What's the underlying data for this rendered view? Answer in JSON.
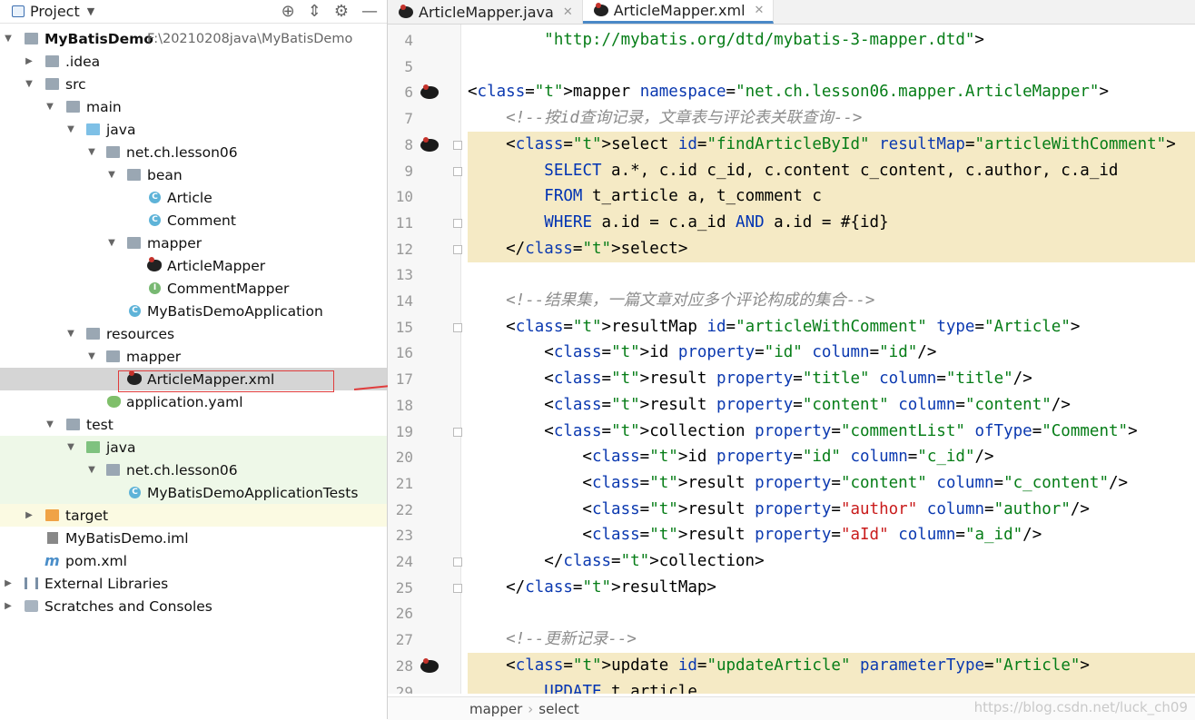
{
  "project_panel": {
    "title": "Project",
    "tree": [
      {
        "label": "MyBatisDemo",
        "path": "F:\\20210208java\\MyBatisDemo",
        "bold": true
      },
      {
        "label": ".idea"
      },
      {
        "label": "src"
      },
      {
        "label": "main"
      },
      {
        "label": "java"
      },
      {
        "label": "net.ch.lesson06"
      },
      {
        "label": "bean"
      },
      {
        "label": "Article"
      },
      {
        "label": "Comment"
      },
      {
        "label": "mapper"
      },
      {
        "label": "ArticleMapper"
      },
      {
        "label": "CommentMapper"
      },
      {
        "label": "MyBatisDemoApplication"
      },
      {
        "label": "resources"
      },
      {
        "label": "mapper"
      },
      {
        "label": "ArticleMapper.xml"
      },
      {
        "label": "application.yaml"
      },
      {
        "label": "test"
      },
      {
        "label": "java"
      },
      {
        "label": "net.ch.lesson06"
      },
      {
        "label": "MyBatisDemoApplicationTests"
      },
      {
        "label": "target"
      },
      {
        "label": "MyBatisDemo.iml"
      },
      {
        "label": "pom.xml"
      },
      {
        "label": "External Libraries"
      },
      {
        "label": "Scratches and Consoles"
      }
    ]
  },
  "tabs": [
    {
      "label": "ArticleMapper.java",
      "active": false
    },
    {
      "label": "ArticleMapper.xml",
      "active": true
    }
  ],
  "editor": {
    "line_numbers": [
      "4",
      "5",
      "6",
      "7",
      "8",
      "9",
      "10",
      "11",
      "12",
      "13",
      "14",
      "15",
      "16",
      "17",
      "18",
      "19",
      "20",
      "21",
      "22",
      "23",
      "24",
      "25",
      "26",
      "27",
      "28",
      "29"
    ],
    "lines": [
      "        \"http://mybatis.org/dtd/mybatis-3-mapper.dtd\">",
      "",
      "<mapper namespace=\"net.ch.lesson06.mapper.ArticleMapper\">",
      "    <!--按id查询记录，文章表与评论表关联查询-->",
      "    <select id=\"findArticleById\" resultMap=\"articleWithComment\">",
      "        SELECT a.*, c.id c_id, c.content c_content, c.author, c.a_id",
      "        FROM t_article a, t_comment c",
      "        WHERE a.id = c.a_id AND a.id = #{id}",
      "    </select>",
      "",
      "    <!--结果集，一篇文章对应多个评论构成的集合-->",
      "    <resultMap id=\"articleWithComment\" type=\"Article\">",
      "        <id property=\"id\" column=\"id\"/>",
      "        <result property=\"title\" column=\"title\"/>",
      "        <result property=\"content\" column=\"content\"/>",
      "        <collection property=\"commentList\" ofType=\"Comment\">",
      "            <id property=\"id\" column=\"c_id\"/>",
      "            <result property=\"content\" column=\"c_content\"/>",
      "            <result property=\"author\" column=\"author\"/>",
      "            <result property=\"aId\" column=\"a_id\"/>",
      "        </collection>",
      "    </resultMap>",
      "",
      "    <!--更新记录-->",
      "    <update id=\"updateArticle\" parameterType=\"Article\">",
      "        UPDATE t_article"
    ]
  },
  "breadcrumb": [
    "mapper",
    "select"
  ],
  "watermark": "https://blog.csdn.net/luck_ch09"
}
